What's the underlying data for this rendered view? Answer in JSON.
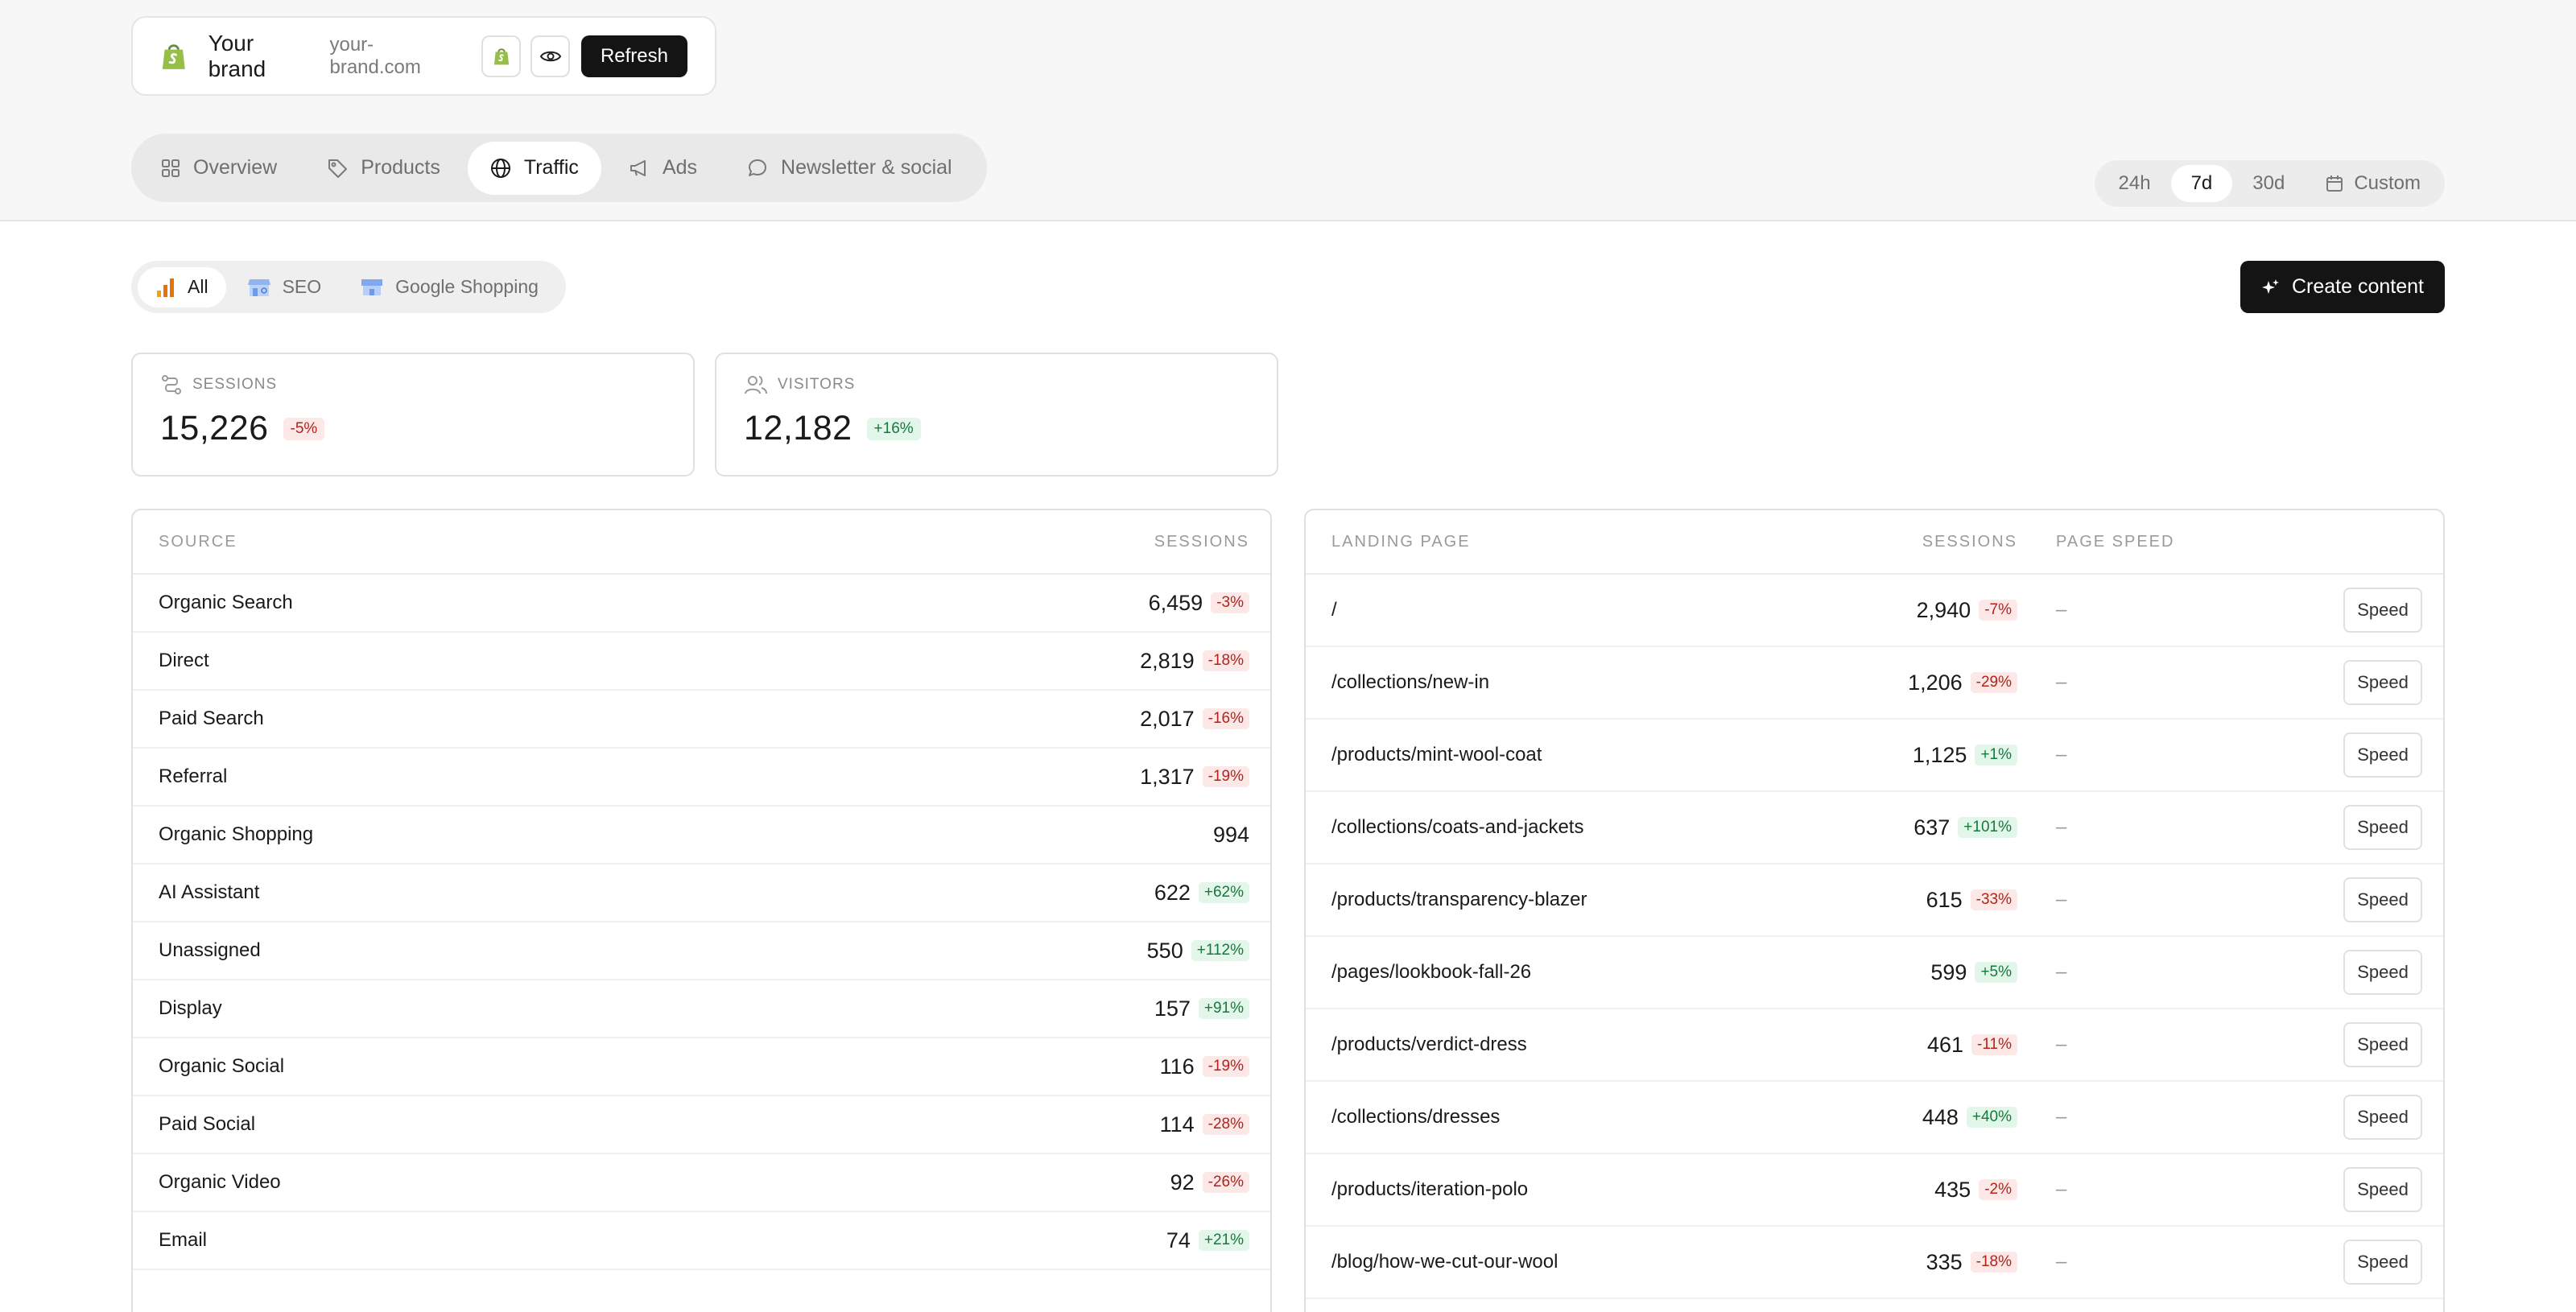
{
  "brand": {
    "name": "Your brand",
    "url": "your-brand.com",
    "refresh_label": "Refresh",
    "logo_icon": "shopify-bag-icon",
    "accent_green": "#95bf47"
  },
  "main_tabs": [
    {
      "label": "Overview",
      "icon": "grid-icon",
      "active": false
    },
    {
      "label": "Products",
      "icon": "tag-icon",
      "active": false
    },
    {
      "label": "Traffic",
      "icon": "globe-icon",
      "active": true
    },
    {
      "label": "Ads",
      "icon": "megaphone-icon",
      "active": false
    },
    {
      "label": "Newsletter & social",
      "icon": "chat-bubble-icon",
      "active": false
    }
  ],
  "range_tabs": [
    {
      "label": "24h",
      "active": false
    },
    {
      "label": "7d",
      "active": true
    },
    {
      "label": "30d",
      "active": false
    },
    {
      "label": "Custom",
      "icon": "calendar-icon",
      "active": false
    }
  ],
  "channel_tabs": [
    {
      "label": "All",
      "icon": "bar-chart-icon",
      "active": true
    },
    {
      "label": "SEO",
      "icon": "seo-icon",
      "active": false
    },
    {
      "label": "Google Shopping",
      "icon": "storefront-icon",
      "active": false
    }
  ],
  "create_button_label": "Create content",
  "stats": {
    "sessions": {
      "label": "SESSIONS",
      "value": "15,226",
      "change": "-5%",
      "trend": "neg"
    },
    "visitors": {
      "label": "VISITORS",
      "value": "12,182",
      "change": "+16%",
      "trend": "pos"
    }
  },
  "sources_table": {
    "headers": {
      "source": "SOURCE",
      "sessions": "SESSIONS"
    },
    "rows": [
      {
        "name": "Organic Search",
        "value": "6,459",
        "change": "-3%",
        "trend": "neg"
      },
      {
        "name": "Direct",
        "value": "2,819",
        "change": "-18%",
        "trend": "neg"
      },
      {
        "name": "Paid Search",
        "value": "2,017",
        "change": "-16%",
        "trend": "neg"
      },
      {
        "name": "Referral",
        "value": "1,317",
        "change": "-19%",
        "trend": "neg"
      },
      {
        "name": "Organic Shopping",
        "value": "994",
        "change": "",
        "trend": ""
      },
      {
        "name": "AI Assistant",
        "value": "622",
        "change": "+62%",
        "trend": "pos"
      },
      {
        "name": "Unassigned",
        "value": "550",
        "change": "+112%",
        "trend": "pos"
      },
      {
        "name": "Display",
        "value": "157",
        "change": "+91%",
        "trend": "pos"
      },
      {
        "name": "Organic Social",
        "value": "116",
        "change": "-19%",
        "trend": "neg"
      },
      {
        "name": "Paid Social",
        "value": "114",
        "change": "-28%",
        "trend": "neg"
      },
      {
        "name": "Organic Video",
        "value": "92",
        "change": "-26%",
        "trend": "neg"
      },
      {
        "name": "Email",
        "value": "74",
        "change": "+21%",
        "trend": "pos"
      }
    ]
  },
  "landing_table": {
    "headers": {
      "page": "LANDING PAGE",
      "sessions": "SESSIONS",
      "speed": "PAGE SPEED"
    },
    "speed_button_label": "Speed",
    "rows": [
      {
        "path": "/",
        "value": "2,940",
        "change": "-7%",
        "trend": "neg",
        "speed": "–"
      },
      {
        "path": "/collections/new-in",
        "value": "1,206",
        "change": "-29%",
        "trend": "neg",
        "speed": "–"
      },
      {
        "path": "/products/mint-wool-coat",
        "value": "1,125",
        "change": "+1%",
        "trend": "pos",
        "speed": "–"
      },
      {
        "path": "/collections/coats-and-jackets",
        "value": "637",
        "change": "+101%",
        "trend": "pos",
        "speed": "–"
      },
      {
        "path": "/products/transparency-blazer",
        "value": "615",
        "change": "-33%",
        "trend": "neg",
        "speed": "–"
      },
      {
        "path": "/pages/lookbook-fall-26",
        "value": "599",
        "change": "+5%",
        "trend": "pos",
        "speed": "–"
      },
      {
        "path": "/products/verdict-dress",
        "value": "461",
        "change": "-11%",
        "trend": "neg",
        "speed": "–"
      },
      {
        "path": "/collections/dresses",
        "value": "448",
        "change": "+40%",
        "trend": "pos",
        "speed": "–"
      },
      {
        "path": "/products/iteration-polo",
        "value": "435",
        "change": "-2%",
        "trend": "neg",
        "speed": "–"
      },
      {
        "path": "/blog/how-we-cut-our-wool",
        "value": "335",
        "change": "-18%",
        "trend": "neg",
        "speed": "–"
      }
    ]
  }
}
